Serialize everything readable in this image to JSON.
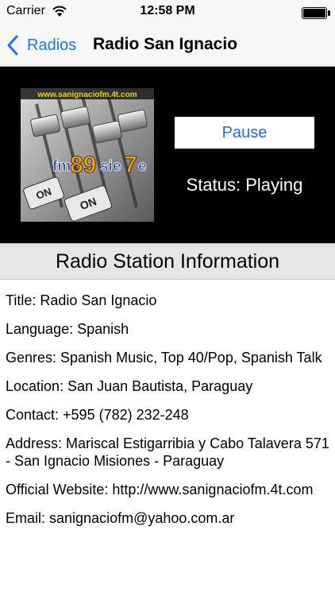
{
  "status_bar": {
    "carrier": "Carrier",
    "time": "12:58 PM",
    "wifi_icon": "wifi-icon",
    "battery_icon": "battery-icon",
    "battery_level": 1.0
  },
  "nav": {
    "back_label": "Radios",
    "back_icon": "chevron-left-icon",
    "title": "Radio San Ignacio",
    "accent_color": "#1478f0"
  },
  "player": {
    "logo_url_text": "www.sanignaciofm.4t.com",
    "logo_brand_prefix": "fm",
    "logo_brand_number": "89",
    "logo_brand_suffix": "sie",
    "logo_brand_digit": "7",
    "logo_brand_tail": "e",
    "logo_switch_label_1": "ON",
    "logo_switch_label_2": "ON",
    "pause_label": "Pause",
    "status_text": "Status: Playing"
  },
  "section": {
    "title": "Radio Station Information"
  },
  "info": {
    "title": "Title: Radio San Ignacio",
    "language": "Language: Spanish",
    "genres": "Genres: Spanish Music, Top 40/Pop, Spanish Talk",
    "location": "Location: San Juan Bautista, Paraguay",
    "contact": "Contact: +595 (782) 232-248",
    "address": "Address: Mariscal Estigarribia y Cabo Talavera 571 - San Ignacio Misiones - Paraguay",
    "website": "Official Website: http://www.sanignaciofm.4t.com",
    "email": "Email: sanignaciofm@yahoo.com.ar"
  }
}
